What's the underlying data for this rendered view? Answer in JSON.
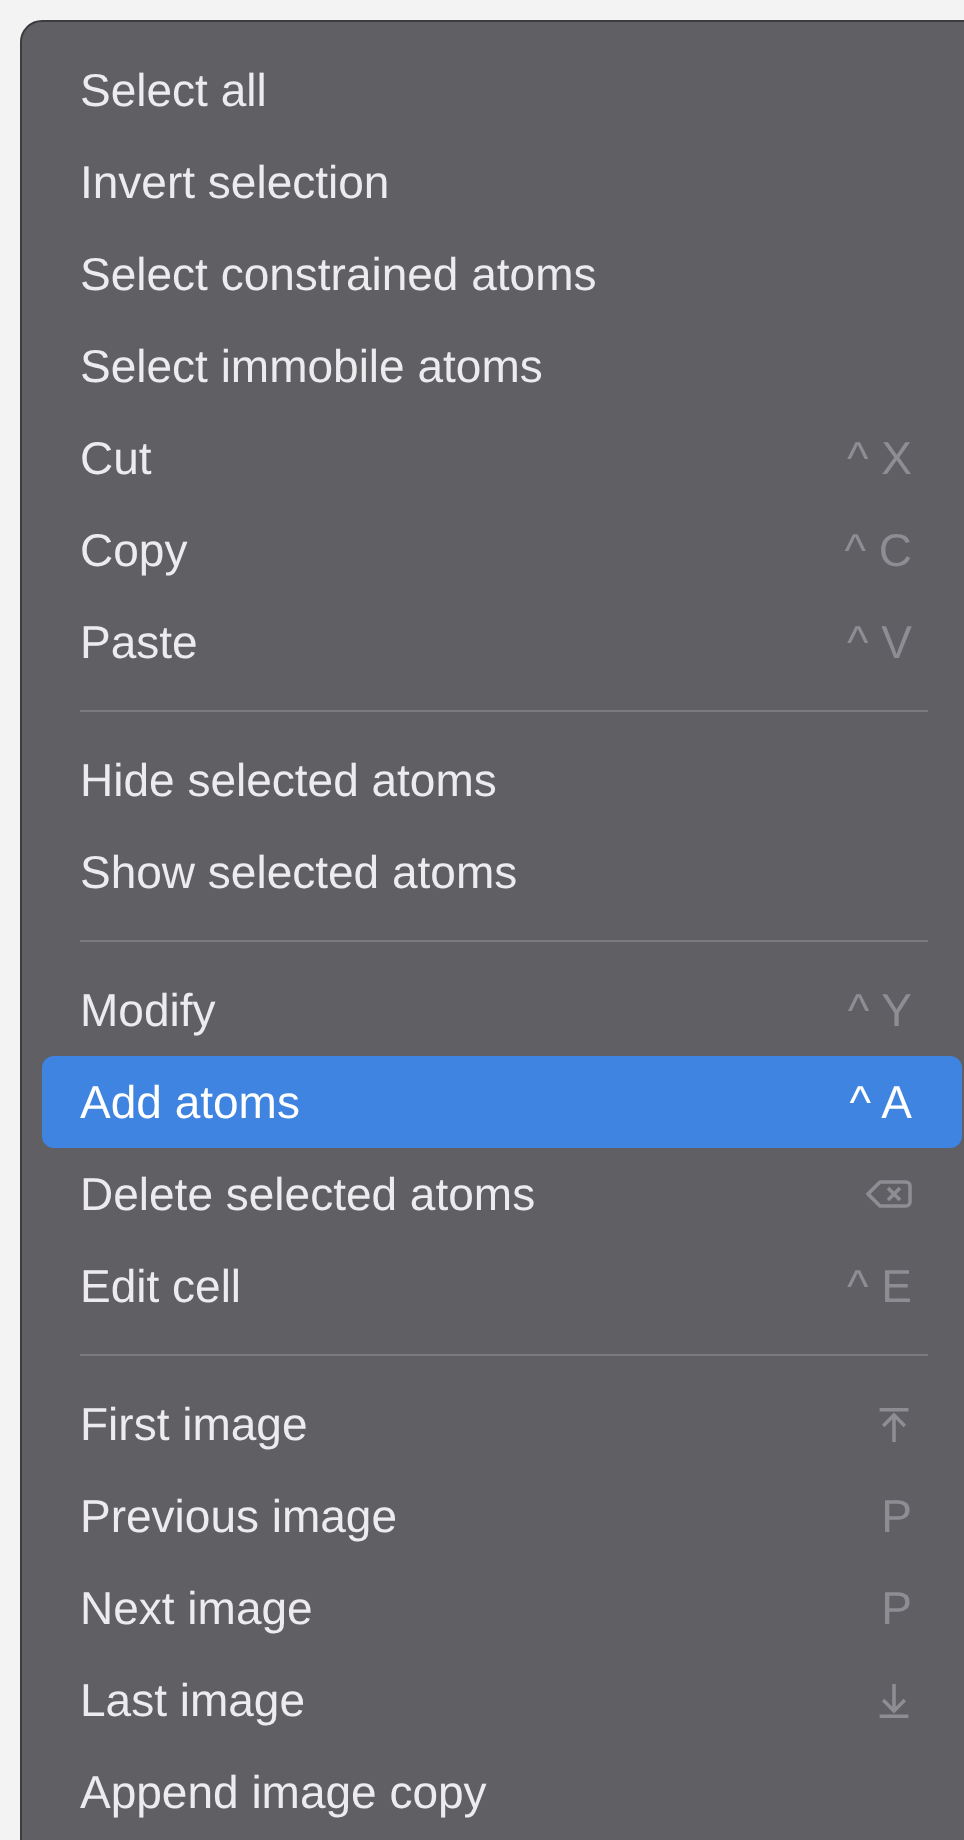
{
  "menu": {
    "sections": [
      {
        "items": [
          {
            "label": "Select all",
            "selected": false
          },
          {
            "label": "Invert selection",
            "selected": false
          },
          {
            "label": "Select constrained atoms",
            "selected": false
          },
          {
            "label": "Select immobile atoms",
            "selected": false
          },
          {
            "label": "Cut",
            "selected": false,
            "shortcut": {
              "kind": "keys",
              "modifier": "^",
              "key": "X"
            }
          },
          {
            "label": "Copy",
            "selected": false,
            "shortcut": {
              "kind": "keys",
              "modifier": "^",
              "key": "C"
            }
          },
          {
            "label": "Paste",
            "selected": false,
            "shortcut": {
              "kind": "keys",
              "modifier": "^",
              "key": "V"
            }
          }
        ]
      },
      {
        "items": [
          {
            "label": "Hide selected atoms",
            "selected": false
          },
          {
            "label": "Show selected atoms",
            "selected": false
          }
        ]
      },
      {
        "items": [
          {
            "label": "Modify",
            "selected": false,
            "shortcut": {
              "kind": "keys",
              "modifier": "^",
              "key": "Y"
            }
          },
          {
            "label": "Add atoms",
            "selected": true,
            "shortcut": {
              "kind": "keys",
              "modifier": "^",
              "key": "A"
            }
          },
          {
            "label": "Delete selected atoms",
            "selected": false,
            "shortcut": {
              "kind": "backspace"
            }
          },
          {
            "label": "Edit cell",
            "selected": false,
            "shortcut": {
              "kind": "keys",
              "modifier": "^",
              "key": "E"
            }
          }
        ]
      },
      {
        "items": [
          {
            "label": "First image",
            "selected": false,
            "shortcut": {
              "kind": "to-top"
            }
          },
          {
            "label": "Previous image",
            "selected": false,
            "shortcut": {
              "kind": "keys",
              "key": "P"
            }
          },
          {
            "label": "Next image",
            "selected": false,
            "shortcut": {
              "kind": "keys",
              "key": "P"
            }
          },
          {
            "label": "Last image",
            "selected": false,
            "shortcut": {
              "kind": "to-bottom"
            }
          },
          {
            "label": "Append image copy",
            "selected": false
          }
        ]
      }
    ]
  }
}
